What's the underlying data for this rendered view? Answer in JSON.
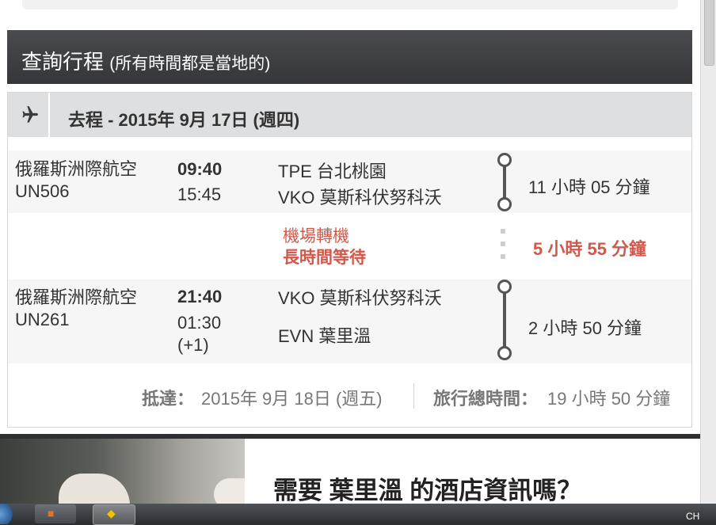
{
  "header": {
    "title": "查詢行程",
    "subtitle": "(所有時間都是當地的)"
  },
  "direction": {
    "icon": "airplane-icon",
    "title": "去程 - 2015年 9月 17日 (週四)"
  },
  "segments": [
    {
      "airline": "俄羅斯洲際航空",
      "flight": "UN506",
      "depart_time": "09:40",
      "arrive_time": "15:45",
      "arrive_extra": "",
      "from": "TPE 台北桃園",
      "to": "VKO 莫斯科伏努科沃",
      "duration": "11 小時 05 分鐘"
    },
    {
      "airline": "俄羅斯洲際航空",
      "flight": "UN261",
      "depart_time": "21:40",
      "arrive_time": "01:30",
      "arrive_extra": "(+1)",
      "from": "VKO 莫斯科伏努科沃",
      "to": "EVN 葉里溫",
      "duration": "2 小時 50 分鐘"
    }
  ],
  "layover": {
    "label": "機場轉機",
    "warning": "長時間等待",
    "duration": "5 小時 55 分鐘"
  },
  "summary": {
    "arrival_label": "抵達：",
    "arrival_value": "2015年 9月 18日 (週五)",
    "total_label": "旅行總時間：",
    "total_value": "19 小時 50 分鐘"
  },
  "hotel": {
    "title": "需要 葉里溫 的酒店資訊嗎？"
  },
  "taskbar": {
    "lang": "CH"
  },
  "colors": {
    "header_bg": "#3d3e42",
    "accent_red": "#d1584a",
    "dirbar_bg": "#dedfe0"
  }
}
